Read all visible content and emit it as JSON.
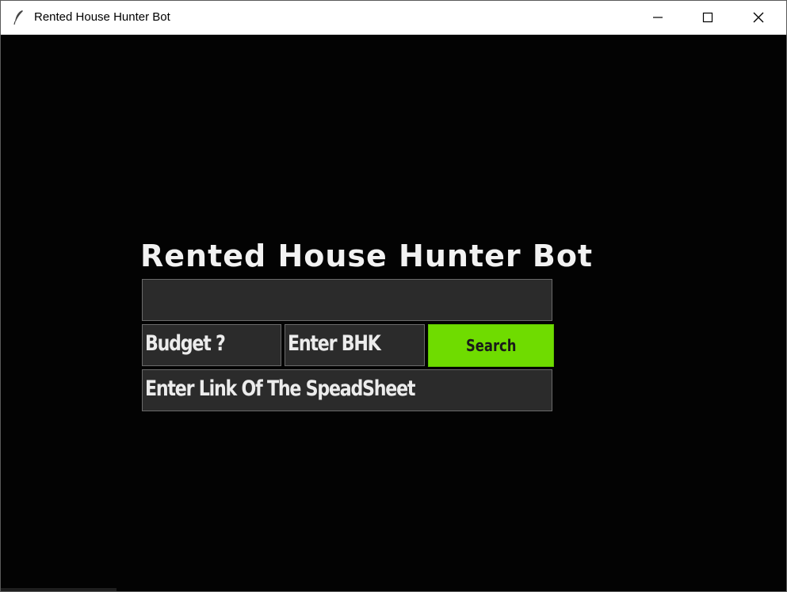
{
  "window": {
    "title": "Rented House Hunter Bot",
    "icon": "feather-icon",
    "controls": [
      "minimize-icon",
      "maximize-icon",
      "close-icon"
    ]
  },
  "app": {
    "heading": "Rented House Hunter Bot",
    "location_input": {
      "value": ""
    },
    "budget_input": {
      "value": "Budget ?"
    },
    "bhk_input": {
      "value": "Enter BHK"
    },
    "search_button": {
      "label": "Search"
    },
    "spreadsheet_input": {
      "value": "Enter Link Of The SpeadSheet"
    }
  },
  "colors": {
    "background": "#030303",
    "field_bg": "#2b2b2b",
    "accent_green": "#6fdc00",
    "text": "#f2f2f2"
  }
}
